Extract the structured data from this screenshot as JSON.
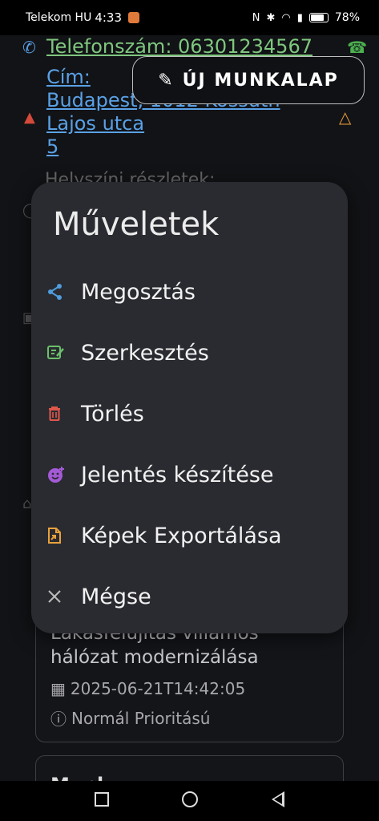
{
  "status_bar": {
    "carrier": "Telekom HU",
    "time": "4:33",
    "battery": "78%"
  },
  "background": {
    "phone_link": "Telefonszám: 06301234567",
    "address_label": "Cím:",
    "address_line1": "Budapest, 1012 Kossuth",
    "address_line2": "Lajos utca",
    "address_line3": "5",
    "faded_text": "Helyszíni részletek:",
    "fab_label": "ÚJ MUNKALAP",
    "card1": {
      "title_line1": "Lakásfelújítás villamos",
      "title_line2": "hálózat modernizálása",
      "date": "2025-06-21T14:42:05",
      "priority": "Normál Prioritású"
    },
    "card2_title": "Munk..."
  },
  "menu": {
    "title": "Műveletek",
    "items": [
      {
        "label": "Megosztás",
        "icon": "share-icon",
        "color": "#4f9de0"
      },
      {
        "label": "Szerkesztés",
        "icon": "edit-icon",
        "color": "#6bbf6b"
      },
      {
        "label": "Törlés",
        "icon": "trash-icon",
        "color": "#e0574b"
      },
      {
        "label": "Jelentés készítése",
        "icon": "report-icon",
        "color": "#a45ad6"
      },
      {
        "label": "Képek Exportálása",
        "icon": "export-image-icon",
        "color": "#e9a13c"
      },
      {
        "label": "Mégse",
        "icon": "close-icon",
        "color": "#bdbdbd"
      }
    ]
  },
  "colors": {
    "link": "#5aa1e6",
    "dialog_bg": "#2a2b30",
    "screen_bg": "#121316"
  }
}
